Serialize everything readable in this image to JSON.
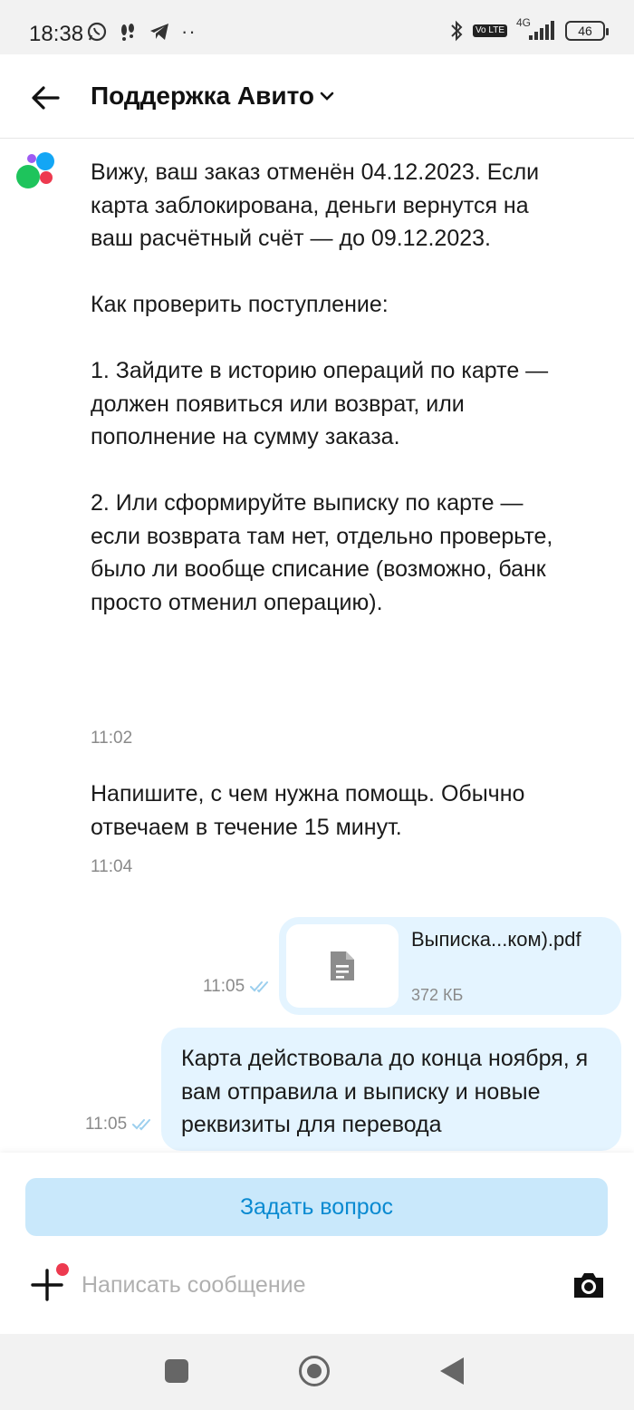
{
  "status_bar": {
    "time": "18:38",
    "battery": "46",
    "network": "4G",
    "volte": "Vo LTE",
    "icons": [
      "whatsapp-icon",
      "notification-icon",
      "telegram-icon",
      "more-dots-icon",
      "bluetooth-icon",
      "volte-icon",
      "signal-icon",
      "battery-icon"
    ]
  },
  "header": {
    "title": "Поддержка Авито",
    "icons": [
      "back-arrow-icon",
      "chevron-down-icon"
    ]
  },
  "messages": [
    {
      "text": "Вижу, ваш заказ отменён 04.12.2023. Если карта заблокирована, деньги вернутся на ваш расчётный счёт — до 09.12.2023.\n\nКак проверить поступление:\n\n1. Зайдите в историю операций по карте — должен появиться или возврат, или пополнение на сумму заказа.\n\n2. Или сформируйте выписку по карте — если возврата там нет, отдельно проверьте, было ли вообще списание (возможно, банк просто отменил операцию).",
      "time": "11:02"
    },
    {
      "text": "Напишите, с чем нужна помощь. Обычно отвечаем в течение 15 минут.",
      "time": "11:04"
    }
  ],
  "outgoing": {
    "file": {
      "name": "Выписка...ком).pdf",
      "size": "372 КБ",
      "time": "11:05"
    },
    "text_message": {
      "text": "Карта действовала до конца ноября, я вам отправила и выписку и новые реквизиты для перевода",
      "time": "11:05"
    }
  },
  "composer": {
    "ask_button": "Задать вопрос",
    "placeholder": "Написать сообщение"
  },
  "colors": {
    "accent": "#0a8ad1",
    "bubble_out": "#e4f4ff",
    "ask_button_bg": "#c9e8fb",
    "read_check": "#9ccfee",
    "notification_dot": "#ed3a4f",
    "logo_green": "#1ec45c",
    "logo_blue": "#13a6f5",
    "logo_red": "#ed3a4f",
    "logo_purple": "#9e5bf2"
  }
}
